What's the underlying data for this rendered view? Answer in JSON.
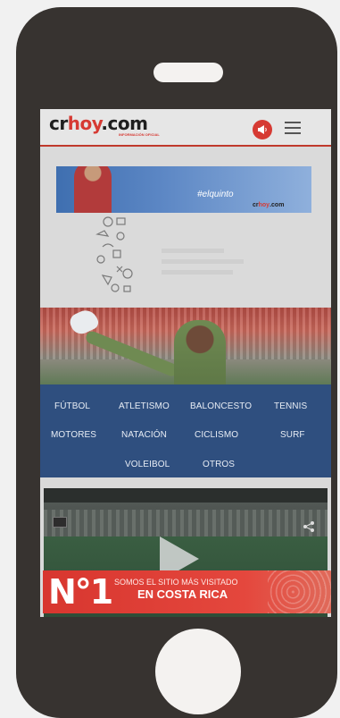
{
  "header": {
    "logo_cr": "cr",
    "logo_hoy": "hoy",
    "logo_com": ".com",
    "tagline": "INFORMACIÓN OFICIAL"
  },
  "ad_banner": {
    "hashtag": "#elquinto",
    "brand_prefix": "cr",
    "brand_hoy": "hoy",
    "brand_suffix": ".com"
  },
  "sports_nav": [
    {
      "label": "FÚTBOL"
    },
    {
      "label": "ATLETISMO"
    },
    {
      "label": "BALONCESTO"
    },
    {
      "label": "TENNIS"
    },
    {
      "label": "MOTORES"
    },
    {
      "label": "NATACIÓN"
    },
    {
      "label": "CICLISMO"
    },
    {
      "label": "SURF"
    },
    {
      "label": "VOLEIBOL"
    },
    {
      "label": "OTROS"
    }
  ],
  "bottom_ad": {
    "rank": "N°1",
    "line1": "SOMOS EL SITIO MÁS VISITADO",
    "line2": "EN COSTA RICA"
  },
  "colors": {
    "phone_body": "#373330",
    "brand_red": "#d63a33",
    "nav_blue": "#2f4f7f"
  },
  "icons": {
    "notify": "megaphone-icon",
    "menu": "hamburger-menu-icon",
    "share": "share-icon",
    "play": "play-icon"
  }
}
